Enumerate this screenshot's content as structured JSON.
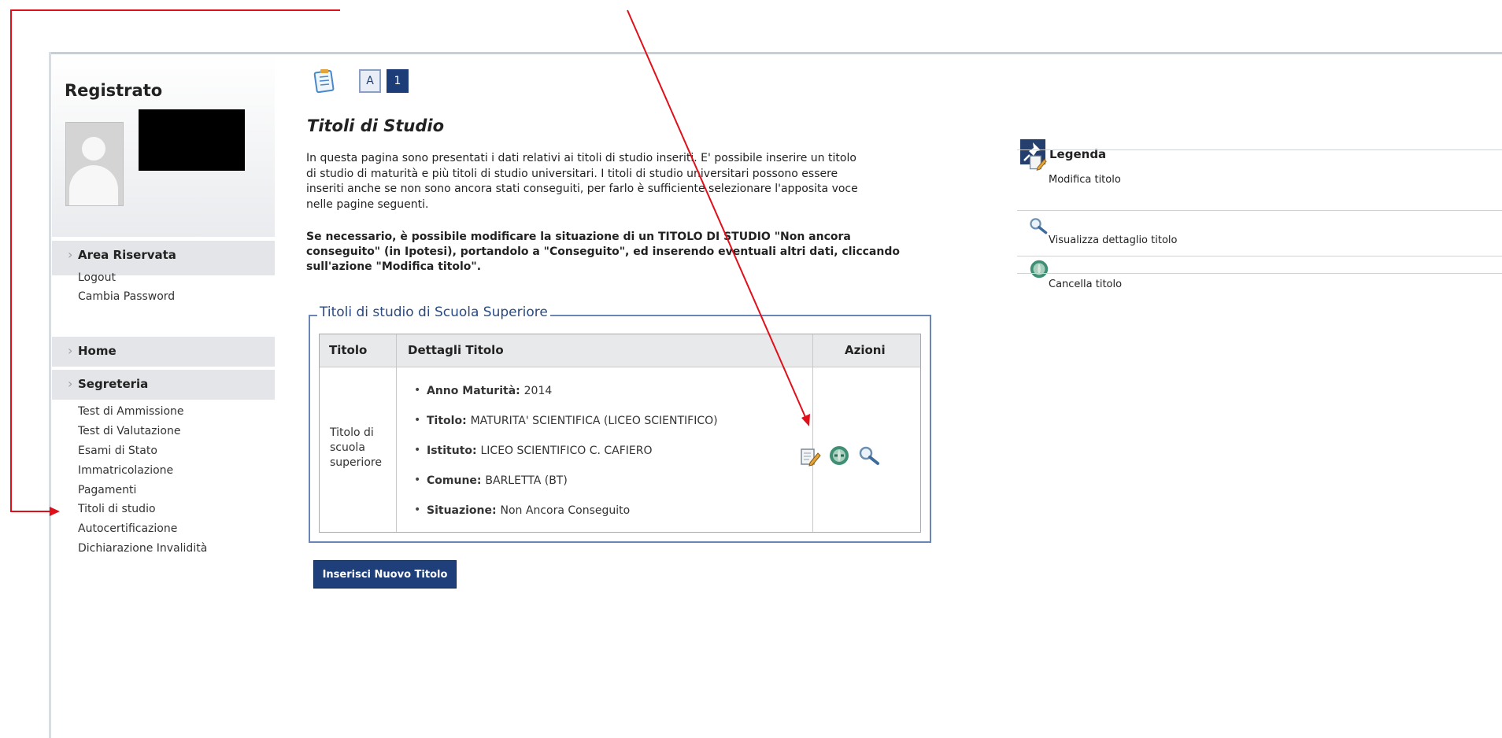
{
  "sidebar": {
    "title": "Registrato",
    "area_riservata": {
      "label": "Area Riservata",
      "links": [
        "Logout",
        "Cambia Password"
      ]
    },
    "home_label": "Home",
    "segreteria": {
      "label": "Segreteria",
      "links": [
        "Test di Ammissione",
        "Test di Valutazione",
        "Esami di Stato",
        "Immatricolazione",
        "Pagamenti",
        "Titoli di studio",
        "Autocertificazione",
        "Dichiarazione Invalidità"
      ]
    }
  },
  "toolbar": {
    "btn_a": "A",
    "btn_1": "1"
  },
  "main": {
    "title": "Titoli di Studio",
    "intro_lines": [
      "In questa pagina sono presentati i dati relativi ai titoli di studio inseriti. E' possibile inserire un titolo",
      "di studio di maturità e più titoli di studio universitari. I titoli di studio universitari possono essere",
      "inseriti anche se non sono ancora stati conseguiti, per farlo è sufficiente selezionare l'apposita voce",
      "nelle pagine seguenti."
    ],
    "note_lines": [
      "Se necessario, è possibile modificare la situazione di un TITOLO DI STUDIO \"Non ancora",
      "conseguito\" (in Ipotesi), portandolo a \"Conseguito\", ed inserendo eventuali altri dati, cliccando",
      "sull'azione \"Modifica titolo\"."
    ],
    "section_legend": "Titoli di studio di Scuola Superiore",
    "table": {
      "headers": [
        "Titolo",
        "Dettagli Titolo",
        "Azioni"
      ],
      "row": {
        "titolo": "Titolo di scuola superiore",
        "details": [
          {
            "key": "Anno Maturità:",
            "value": "2014"
          },
          {
            "key": "Titolo:",
            "value": "MATURITA' SCIENTIFICA (LICEO SCIENTIFICO)"
          },
          {
            "key": "Istituto:",
            "value": "LICEO SCIENTIFICO C. CAFIERO"
          },
          {
            "key": "Comune:",
            "value": "BARLETTA (BT)"
          },
          {
            "key": "Situazione:",
            "value": "Non Ancora Conseguito"
          }
        ]
      }
    },
    "insert_button": "Inserisci Nuovo Titolo"
  },
  "legenda": {
    "title": "Legenda",
    "items": [
      "Modifica titolo",
      "Visualizza dettaglio titolo",
      "Cancella titolo"
    ]
  },
  "colors": {
    "annotation": "#e0101a",
    "primary": "#1f3f7a",
    "border": "#6b86b6"
  }
}
